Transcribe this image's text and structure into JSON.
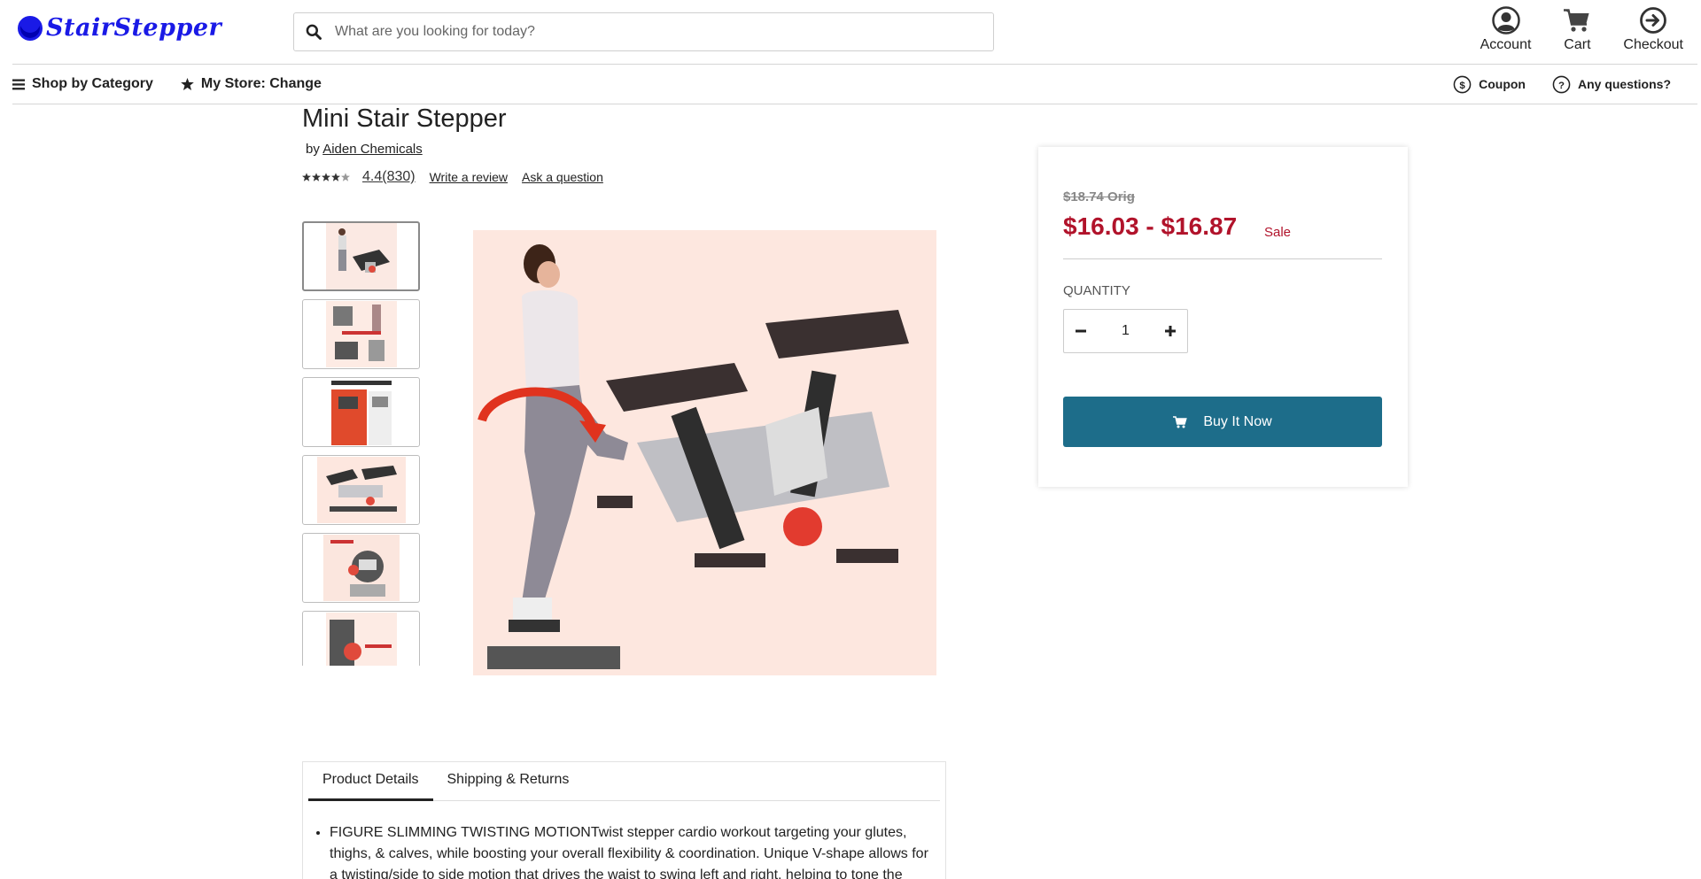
{
  "brand": {
    "name": "StairStepper",
    "color": "#1a1ae6"
  },
  "search": {
    "placeholder": "What are you looking for today?"
  },
  "header": {
    "account_label": "Account",
    "cart_label": "Cart",
    "checkout_label": "Checkout"
  },
  "nav": {
    "shop_by_category": "Shop by Category",
    "my_store": "My Store: Change",
    "coupon": "Coupon",
    "questions": "Any questions?"
  },
  "product": {
    "title": "Mini Stair Stepper",
    "by_prefix": "by",
    "brand": "Aiden Chemicals",
    "rating": "4.4(830)",
    "star_count": 4,
    "write_review": "Write a review",
    "ask_question": "Ask a question",
    "thumbnails": [
      "stepper-with-woman",
      "twist-action",
      "how-we-measure-up",
      "stepper-side-view",
      "digital-monitor",
      "adjustable"
    ]
  },
  "pricing": {
    "original": "$18.74 Orig",
    "price_range": "$16.03 - $16.87",
    "sale_label": "Sale",
    "quantity_label": "QUANTITY",
    "quantity_value": "1",
    "buy_label": "Buy It Now",
    "accent_color": "#b1132b",
    "button_color": "#1d6d8a"
  },
  "tabs": {
    "items": [
      "Product Details",
      "Shipping & Returns"
    ],
    "active": "Product Details"
  },
  "details": {
    "bullet_1": "FIGURE SLIMMING TWISTING MOTIONTwist stepper cardio workout targeting your glutes, thighs, & calves, while boosting your overall flexibility & coordination. Unique V-shape allows for a twisting/side to side motion that drives the waist to swing left and right, helping to tone the"
  }
}
